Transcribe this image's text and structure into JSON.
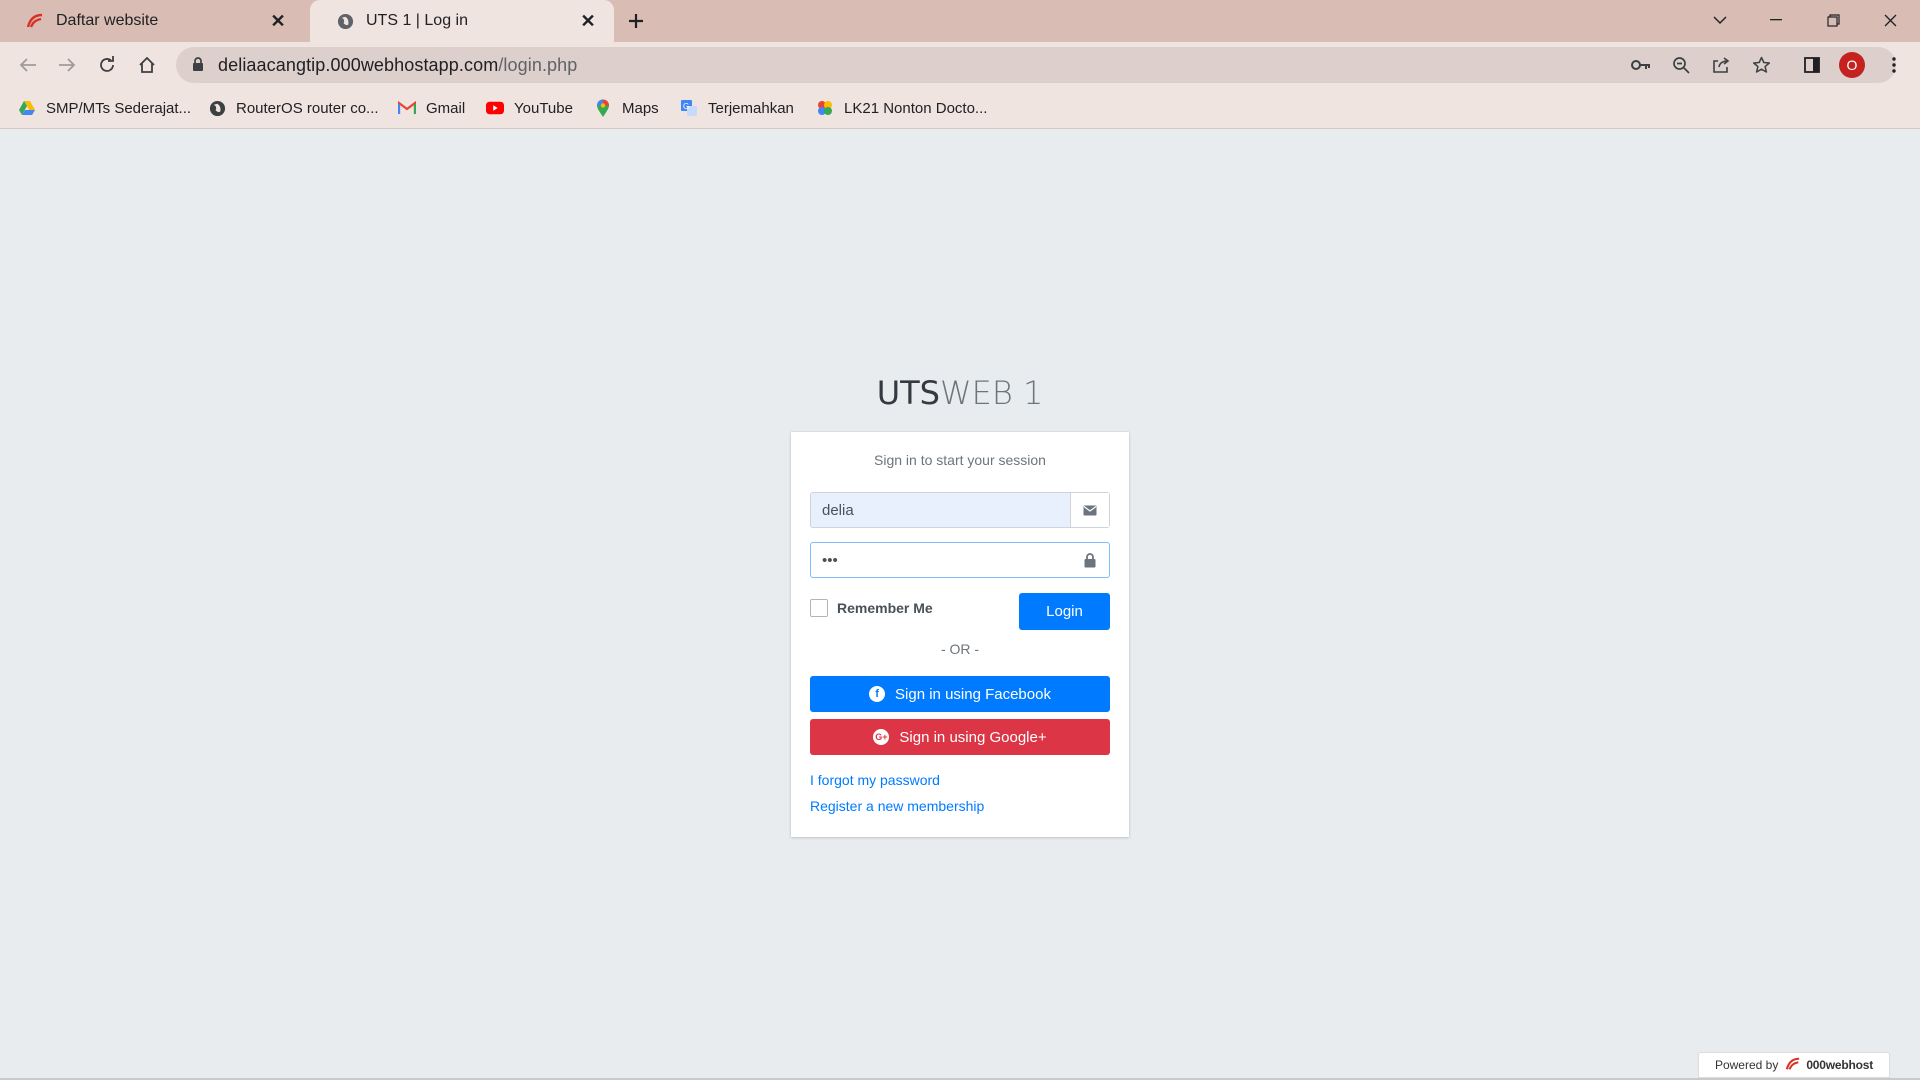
{
  "browser": {
    "tabs": [
      {
        "label": "Daftar website",
        "active": false
      },
      {
        "label": "UTS 1 | Log in",
        "active": true
      }
    ],
    "url": {
      "host": "deliaacangtip.000webhostapp.com",
      "path": "/login.php"
    },
    "profile_initial": "O",
    "bookmarks": [
      {
        "label": "SMP/MTs Sederajat...",
        "icon": "google-drive-icon"
      },
      {
        "label": "RouterOS router co...",
        "icon": "globe-icon"
      },
      {
        "label": "Gmail",
        "icon": "gmail-icon"
      },
      {
        "label": "YouTube",
        "icon": "youtube-icon"
      },
      {
        "label": "Maps",
        "icon": "maps-pin-icon"
      },
      {
        "label": "Terjemahkan",
        "icon": "translate-icon"
      },
      {
        "label": "LK21 Nonton Docto...",
        "icon": "lk21-icon"
      }
    ]
  },
  "page": {
    "logo_bold": "UTS",
    "logo_light": "WEB 1",
    "login_message": "Sign in to start your session",
    "username_value": "delia",
    "password_value": "•••",
    "remember_label": "Remember Me",
    "remember_checked": false,
    "login_label": "Login",
    "or_label": "- OR -",
    "facebook_label": "Sign in using Facebook",
    "google_label": "Sign in using Google+",
    "forgot_link": "I forgot my password",
    "register_link": "Register a new membership"
  },
  "footer": {
    "powered_by": "Powered by",
    "brand": "000webhost"
  },
  "colors": {
    "primary": "#007bff",
    "danger": "#dc3545",
    "page_background": "#e9ecef",
    "tabbar": "#d9bcb4"
  }
}
